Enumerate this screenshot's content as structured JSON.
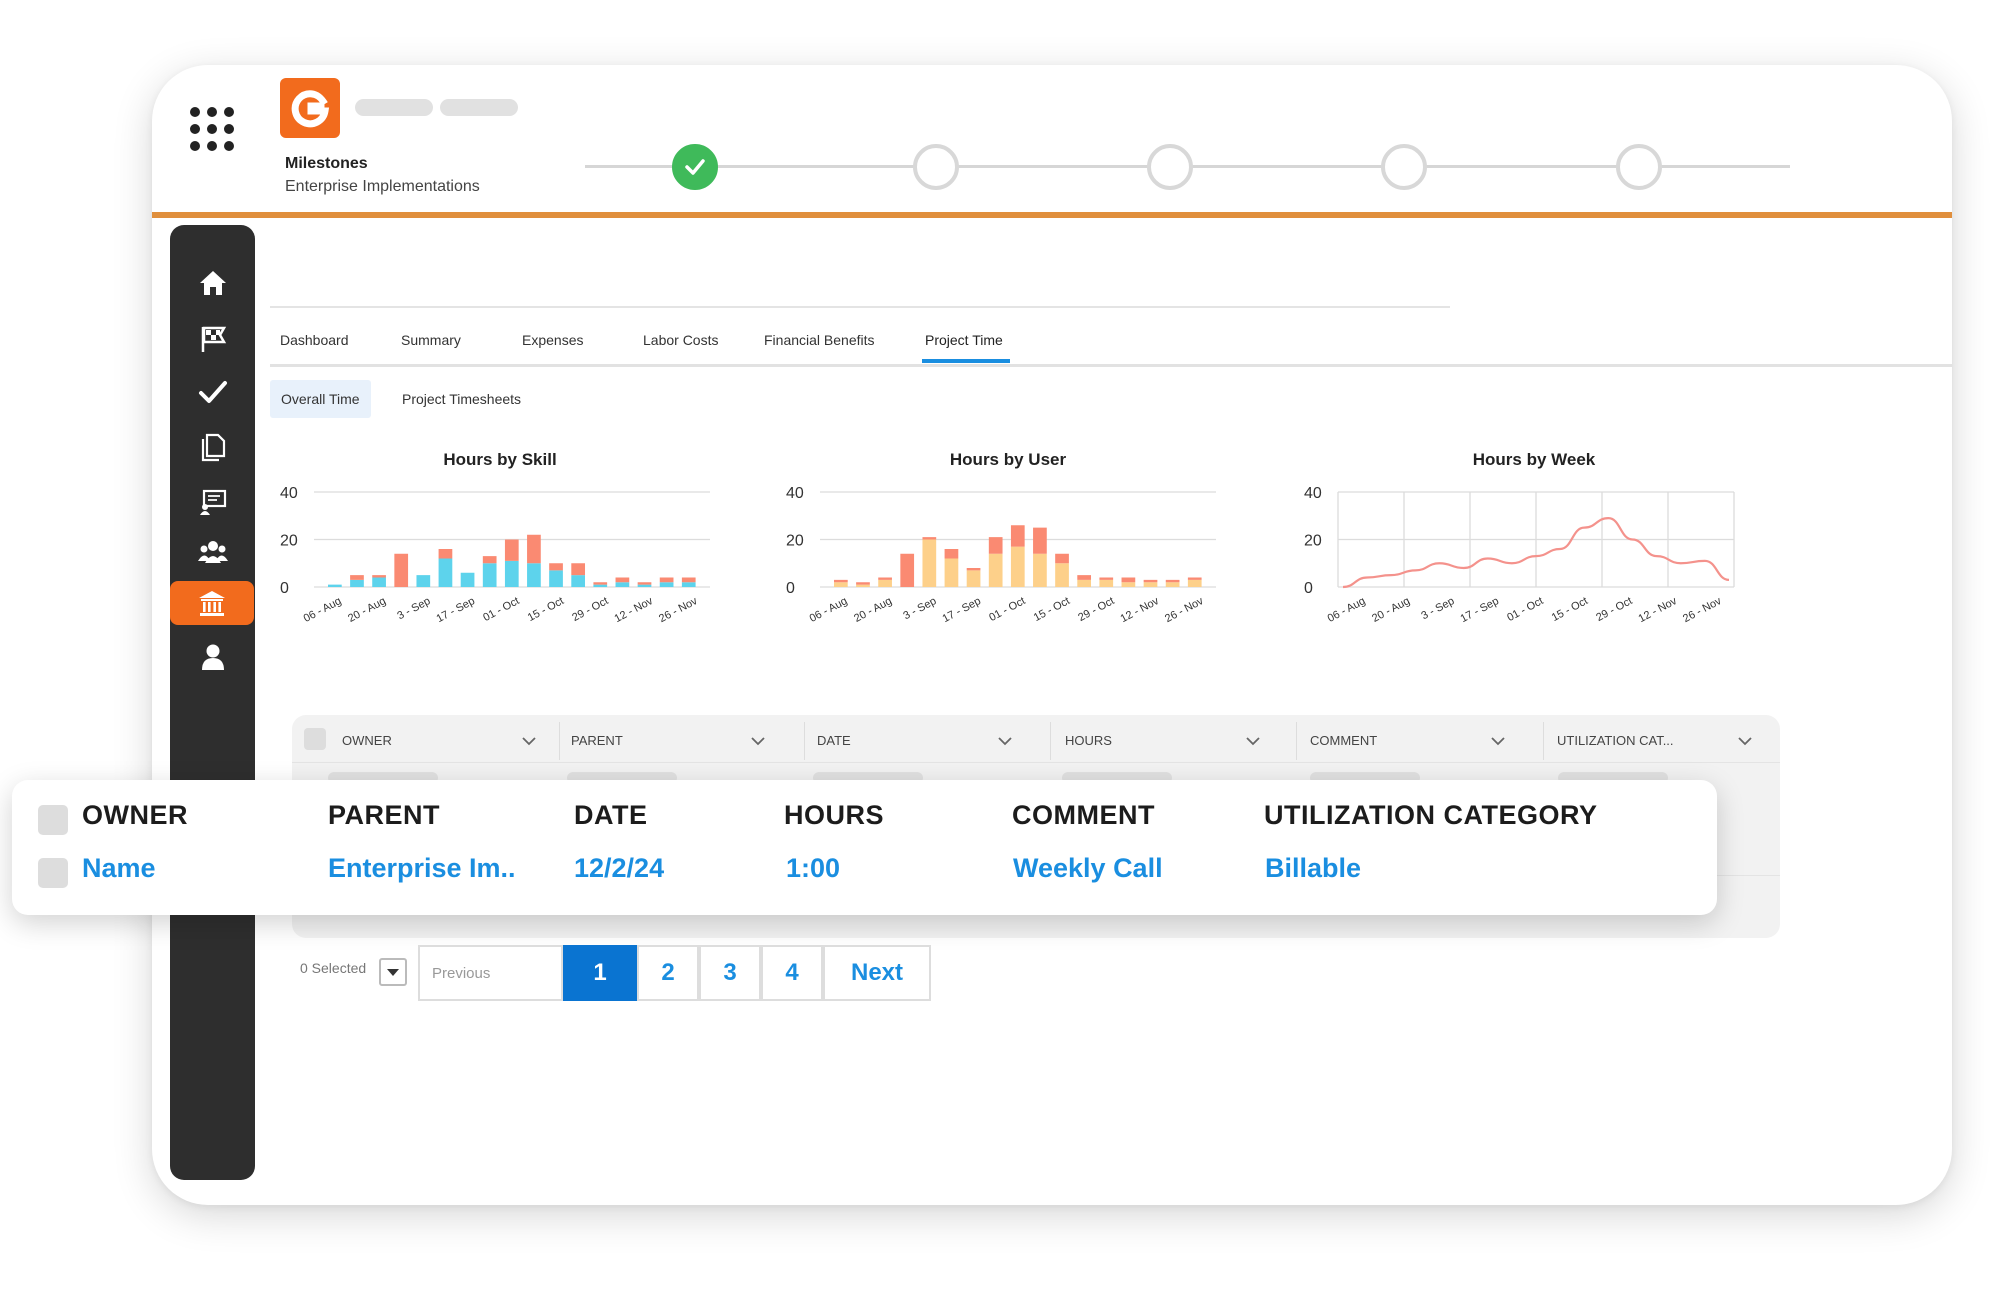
{
  "header": {
    "project_label": "Milestones",
    "project_sub": "Enterprise Implementations",
    "milestones": [
      {
        "status": "done"
      },
      {
        "status": "pending"
      },
      {
        "status": "pending"
      },
      {
        "status": "pending"
      },
      {
        "status": "pending"
      }
    ]
  },
  "sidebar": {
    "items": [
      {
        "icon": "home-icon"
      },
      {
        "icon": "flag-icon"
      },
      {
        "icon": "check-icon"
      },
      {
        "icon": "documents-icon"
      },
      {
        "icon": "presentation-icon"
      },
      {
        "icon": "team-icon"
      },
      {
        "icon": "bank-icon",
        "active": true
      },
      {
        "icon": "user-icon"
      }
    ]
  },
  "tabs": [
    "Dashboard",
    "Summary",
    "Expenses",
    "Labor Costs",
    "Financial Benefits",
    "Project Time"
  ],
  "active_tab": "Project Time",
  "subtabs": [
    "Overall Time",
    "Project Timesheets"
  ],
  "active_subtab": "Overall Time",
  "colors": {
    "accent": "#f26b1d",
    "blue": "#1a8ee0",
    "bar_salmon": "#fa8a72",
    "bar_cyan": "#5dd3ec",
    "bar_yellow": "#fdd08a",
    "line_pink": "#f4928c",
    "success": "#3fba5a"
  },
  "chart_data": [
    {
      "type": "bar",
      "title": "Hours by Skill",
      "categories": [
        "06 - Aug",
        "",
        "20 - Aug",
        "",
        "3 - Sep",
        "",
        "17 - Sep",
        "",
        "01 - Oct",
        "",
        "15 - Oct",
        "",
        "29 - Oct",
        "",
        "12 - Nov",
        "",
        "26 - Nov"
      ],
      "tick_labels": [
        "06 - Aug",
        "20 - Aug",
        "3 - Sep",
        "17 - Sep",
        "01 - Oct",
        "15 - Oct",
        "29 - Oct",
        "12 - Nov",
        "26 - Nov"
      ],
      "series": [
        {
          "values": [
            1,
            3,
            4,
            0,
            5,
            12,
            6,
            10,
            11,
            10,
            7,
            5,
            1,
            2,
            1,
            2,
            2
          ],
          "color": "#5dd3ec"
        },
        {
          "values": [
            0,
            2,
            1,
            14,
            0,
            4,
            0,
            3,
            9,
            12,
            3,
            5,
            1,
            2,
            1,
            2,
            2
          ],
          "color": "#fa8a72"
        }
      ],
      "stacked": true,
      "ylim": [
        0,
        40
      ],
      "yticks": [
        0,
        20,
        40
      ]
    },
    {
      "type": "bar",
      "title": "Hours by User",
      "categories": [
        "06 - Aug",
        "",
        "20 - Aug",
        "",
        "3 - Sep",
        "",
        "17 - Sep",
        "",
        "01 - Oct",
        "",
        "15 - Oct",
        "",
        "29 - Oct",
        "",
        "12 - Nov",
        "",
        "26 - Nov"
      ],
      "tick_labels": [
        "06 - Aug",
        "20 - Aug",
        "3 - Sep",
        "17 - Sep",
        "01 - Oct",
        "15 - Oct",
        "29 - Oct",
        "12 - Nov",
        "26 - Nov"
      ],
      "series": [
        {
          "values": [
            2,
            1,
            3,
            0,
            20,
            12,
            7,
            14,
            17,
            14,
            10,
            3,
            3,
            2,
            2,
            2,
            3
          ],
          "color": "#fdd08a"
        },
        {
          "values": [
            1,
            1,
            1,
            14,
            1,
            4,
            1,
            7,
            9,
            11,
            4,
            2,
            1,
            2,
            1,
            1,
            1
          ],
          "color": "#fa8a72"
        }
      ],
      "stacked": true,
      "ylim": [
        0,
        40
      ],
      "yticks": [
        0,
        20,
        40
      ]
    },
    {
      "type": "line",
      "title": "Hours by Week",
      "tick_labels": [
        "06 - Aug",
        "20 - Aug",
        "3 - Sep",
        "17 - Sep",
        "01 - Oct",
        "15 - Oct",
        "29 - Oct",
        "12 - Nov",
        "26 - Nov"
      ],
      "values": [
        0,
        4,
        5,
        7,
        10,
        8,
        12,
        10,
        13,
        16,
        25,
        29,
        20,
        13,
        10,
        11,
        3
      ],
      "color": "#f4928c",
      "ylim": [
        0,
        40
      ],
      "yticks": [
        0,
        20,
        40
      ],
      "grid": true
    }
  ],
  "table": {
    "columns": [
      "OWNER",
      "PARENT",
      "DATE",
      "HOURS",
      "COMMENT",
      "UTILIZATION CAT..."
    ]
  },
  "overlay": {
    "headers": [
      "OWNER",
      "PARENT",
      "DATE",
      "HOURS",
      "COMMENT",
      "UTILIZATION CATEGORY"
    ],
    "row": [
      "Name",
      "Enterprise Im..",
      "12/2/24",
      "1:00",
      "Weekly Call",
      "Billable"
    ]
  },
  "pagination": {
    "selected_text": "0 Selected",
    "previous": "Previous",
    "pages": [
      "1",
      "2",
      "3",
      "4"
    ],
    "active_page": "1",
    "next": "Next"
  }
}
